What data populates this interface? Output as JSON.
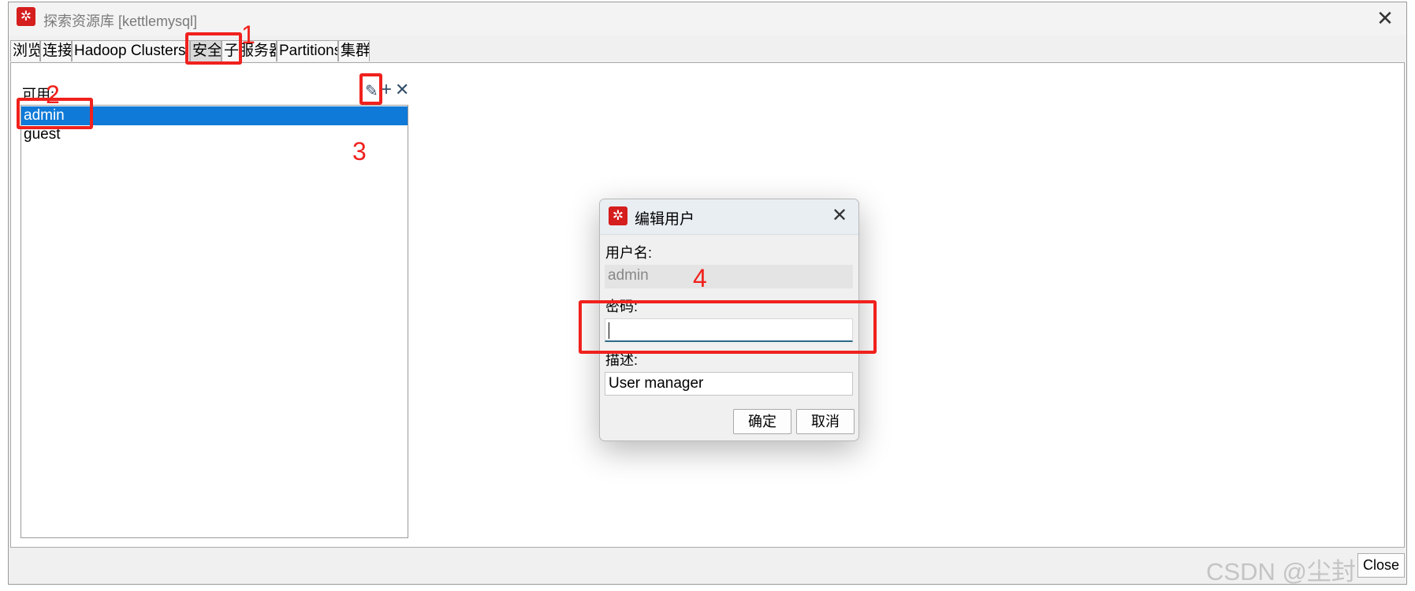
{
  "window": {
    "title": "探索资源库 [kettlemysql]",
    "icon_name": "kettle-app-icon",
    "close_icon": "close-icon"
  },
  "tabs": [
    {
      "label": "浏览"
    },
    {
      "label": "连接"
    },
    {
      "label": "Hadoop Clusters"
    },
    {
      "label": "安全",
      "active": true
    },
    {
      "label": "子服务器"
    },
    {
      "label": "Partitions"
    },
    {
      "label": "集群"
    }
  ],
  "security": {
    "available_label": "可用:",
    "toolbar": {
      "edit_icon": "pencil-icon",
      "add_icon": "plus-icon",
      "delete_icon": "x-icon"
    },
    "users": [
      "admin",
      "guest"
    ],
    "selected_user": "admin"
  },
  "bottom": {
    "close_label": "Close"
  },
  "dialog": {
    "title": "编辑用户",
    "username_label": "用户名:",
    "username_value": "admin",
    "password_label": "密码:",
    "password_value": "",
    "description_label": "描述:",
    "description_value": "User manager",
    "ok_label": "确定",
    "cancel_label": "取消"
  },
  "annotations": [
    "1",
    "2",
    "3",
    "4"
  ],
  "watermark": "CSDN @尘封"
}
